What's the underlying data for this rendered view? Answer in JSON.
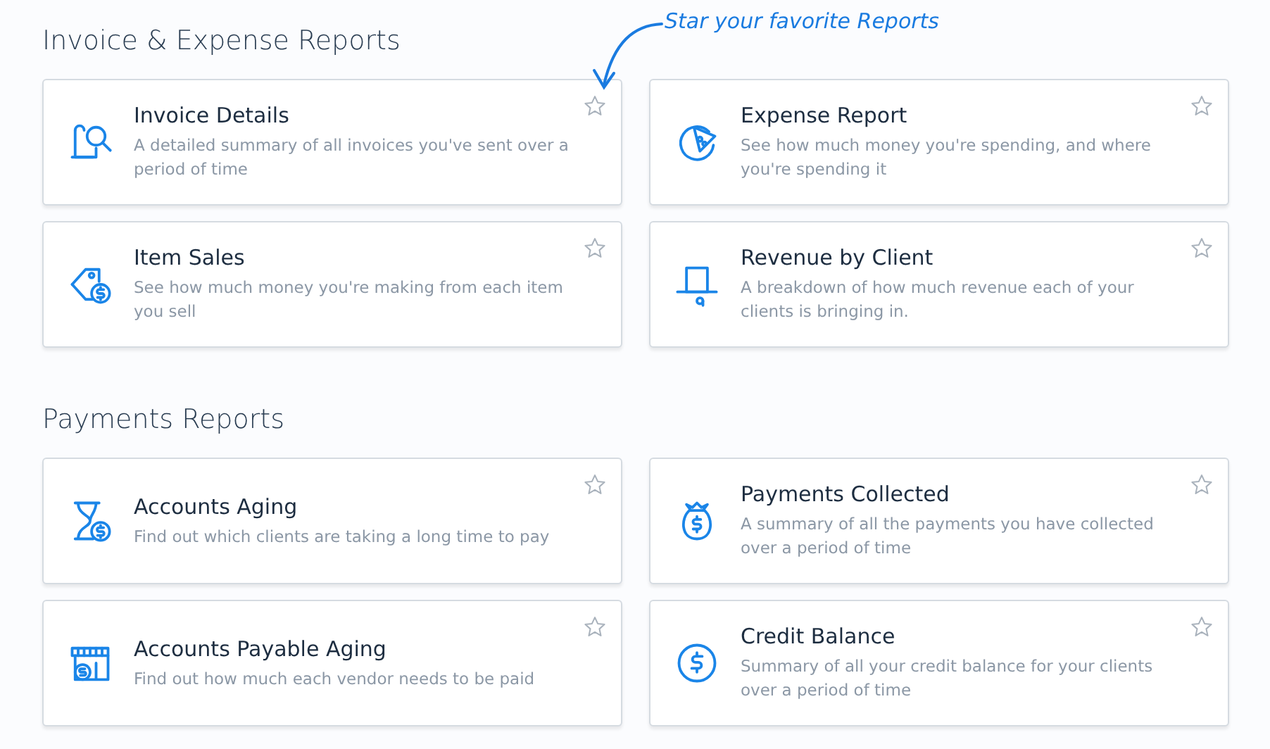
{
  "annotation": {
    "text": "Star your favorite Reports"
  },
  "sections": [
    {
      "title": "Invoice & Expense Reports",
      "reports": [
        {
          "kind": "invoice",
          "title": "Invoice Details",
          "description": "A detailed summary of all invoices you've sent over a period of time",
          "starred": false
        },
        {
          "kind": "expense",
          "title": "Expense Report",
          "description": "See how much money you're spending, and where you're spending it",
          "starred": false
        },
        {
          "kind": "item-sales",
          "title": "Item Sales",
          "description": "See how much money you're making from each item you sell",
          "starred": false
        },
        {
          "kind": "revenue",
          "title": "Revenue by Client",
          "description": "A breakdown of how much revenue each of your clients is bringing in.",
          "starred": false
        }
      ]
    },
    {
      "title": "Payments Reports",
      "reports": [
        {
          "kind": "aging",
          "title": "Accounts Aging",
          "description": "Find out which clients are taking a long time to pay",
          "starred": false
        },
        {
          "kind": "collected",
          "title": "Payments Collected",
          "description": "A summary of all the payments you have collected over a period of time",
          "starred": false
        },
        {
          "kind": "payable",
          "title": "Accounts Payable Aging",
          "description": "Find out how much each vendor needs to be paid",
          "starred": false
        },
        {
          "kind": "credit",
          "title": "Credit Balance",
          "description": "Summary of all your credit balance for your clients over a period of time",
          "starred": false
        }
      ]
    }
  ]
}
